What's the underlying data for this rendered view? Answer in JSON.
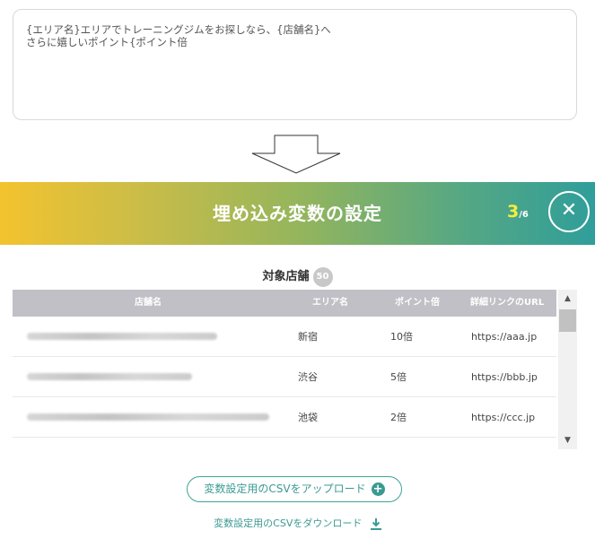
{
  "message": {
    "line1": "{エリア名}エリアでトレーニングジムをお探しなら、{店舗名}へ",
    "line2": "さらに嬉しいポイント{ポイント倍"
  },
  "banner": {
    "title": "埋め込み変数の設定",
    "step_current": "3",
    "step_total": "/6",
    "close_symbol": "✕",
    "gradient_colors": [
      "#f3c32e",
      "#95b55c",
      "#2f9e9a"
    ]
  },
  "target": {
    "label": "対象店舗",
    "count": "50"
  },
  "table": {
    "headers": [
      "店舗名",
      "エリア名",
      "ポイント倍",
      "詳細リンクのURL"
    ],
    "rows": [
      {
        "area": "新宿",
        "points": "10倍",
        "url": "https://aaa.jp"
      },
      {
        "area": "渋谷",
        "points": "5倍",
        "url": "https://bbb.jp"
      },
      {
        "area": "池袋",
        "points": "2倍",
        "url": "https://ccc.jp"
      }
    ],
    "scroll_up": "▲",
    "scroll_down": "▼"
  },
  "actions": {
    "upload_label": "変数設定用のCSVをアップロード",
    "download_label": "変数設定用のCSVをダウンロード"
  },
  "colors": {
    "accent": "#3a9a93",
    "header_bg": "#c0c0c6"
  },
  "icons": {
    "arrow": "down-arrow-icon",
    "close": "close-icon",
    "upload": "plus-circle-icon",
    "download": "download-icon"
  }
}
